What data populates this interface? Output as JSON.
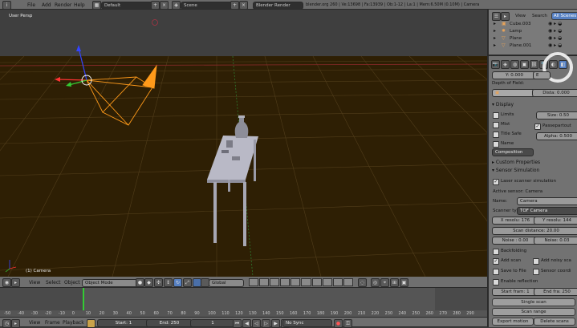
{
  "top_menu": {
    "items": [
      "File",
      "Add",
      "Render",
      "Help"
    ],
    "layout": "Default",
    "scene": "Scene",
    "engine": "Blender Render",
    "info": "blender.org 260 | Ve:13698 | Fa:13939 | Ob:1-12 | La:1 | Mem:6.50M (0.10M) | Camera"
  },
  "viewport": {
    "label": "User Persp",
    "object_label": "(1) Camera"
  },
  "view_header": {
    "menus": [
      "View",
      "Select",
      "Object"
    ],
    "mode": "Object Mode",
    "orientation": "Global"
  },
  "timeline": {
    "ticks": [
      "-50",
      "-40",
      "-30",
      "-20",
      "-10",
      "0",
      "10",
      "20",
      "30",
      "40",
      "50",
      "60",
      "70",
      "80",
      "90",
      "100",
      "110",
      "120",
      "130",
      "140",
      "150",
      "160",
      "170",
      "180",
      "190",
      "200",
      "210",
      "220",
      "230",
      "240",
      "250",
      "260",
      "270",
      "280",
      "290"
    ],
    "menus": [
      "View",
      "Frame",
      "Playback"
    ],
    "start": "Start: 1",
    "end": "End: 250",
    "current": "1",
    "sync": "No Sync"
  },
  "outliner": {
    "tabs": [
      "View",
      "Search",
      "All Scenes"
    ],
    "items": [
      "Cube.003",
      "Lamp",
      "Plane",
      "Plane.001"
    ]
  },
  "properties": {
    "y_field": "Y: 0.000",
    "dof_title": "Depth of Field:",
    "dist": "Dista: 0.000",
    "display": {
      "title": "Display",
      "limits": "Limits",
      "size": "Size: 0.50",
      "mist": "Mist",
      "passepartout": "Passepartout",
      "title_safe": "Title Safe",
      "alpha": "Alpha: 0.500",
      "name": "Name",
      "composition": "Composition"
    },
    "custom_props": "Custom Properties",
    "sensor_sim": {
      "title": "Sensor Simulation",
      "laser": "Laser scanner simulation",
      "active": "Active sensor: Camera",
      "name_label": "Name:",
      "name_value": "Camera",
      "scanner_label": "Scanner ty",
      "scanner_value": "TOF Camera",
      "x_res": "X resolu: 176",
      "y_res": "Y resolu: 144",
      "scan_distance": "Scan distance: 20.00",
      "noise1": "Noise : 0.00",
      "noise2": "Noise: 0.03",
      "backfolding": "Backfolding",
      "add_scan": "Add scan",
      "add_noisy": "Add noisy sca",
      "save_file": "Save to File",
      "sensor_coord": "Sensor coordi",
      "enable_reflection": "Enable reflection",
      "start_frame": "Start fram: 1",
      "end_frame": "End fra: 250",
      "single_scan": "Single scan",
      "scan_range": "Scan range",
      "export_motion": "Export motion",
      "delete_scans": "Delete scans"
    }
  },
  "colors": {
    "viewport_bg": "#2e1f04",
    "grid": "#5a4520",
    "camera": "#ff9a1a",
    "accent": "#5680c2"
  }
}
